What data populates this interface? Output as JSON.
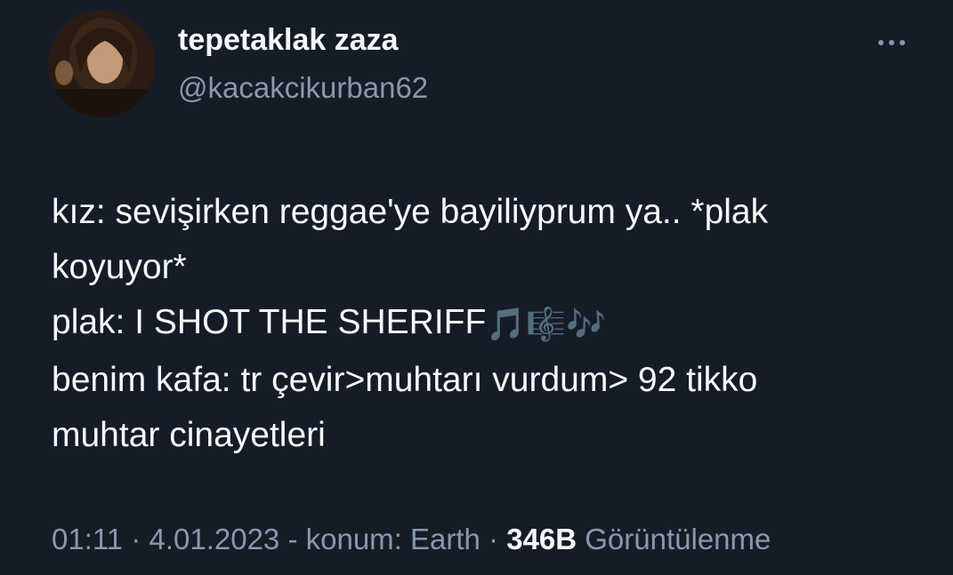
{
  "user": {
    "display_name": "tepetaklak zaza",
    "handle": "@kacakcikurban62"
  },
  "more_icon": "more-horizontal-icon",
  "tweet": {
    "lines": [
      "kız: sevişirken reggae'ye bayiliyprum ya.. *plak",
      "koyuyor*",
      "plak: I SHOT THE SHERIFF",
      "benim kafa: tr çevir>muhtarı vurdum> 92 tikko",
      "muhtar cinayetleri"
    ],
    "emojis": [
      "🎵",
      "🎼",
      "🎶"
    ]
  },
  "meta": {
    "time": "01:11",
    "sep1": " · ",
    "date": "4.01.2023",
    "location": " - konum: Earth",
    "sep2": " · ",
    "views_count": "346B",
    "views_label": " Görüntülenme"
  },
  "colors": {
    "background": "#151c28",
    "primary_text": "#f7f9f9",
    "secondary_text": "#8b98a5"
  }
}
